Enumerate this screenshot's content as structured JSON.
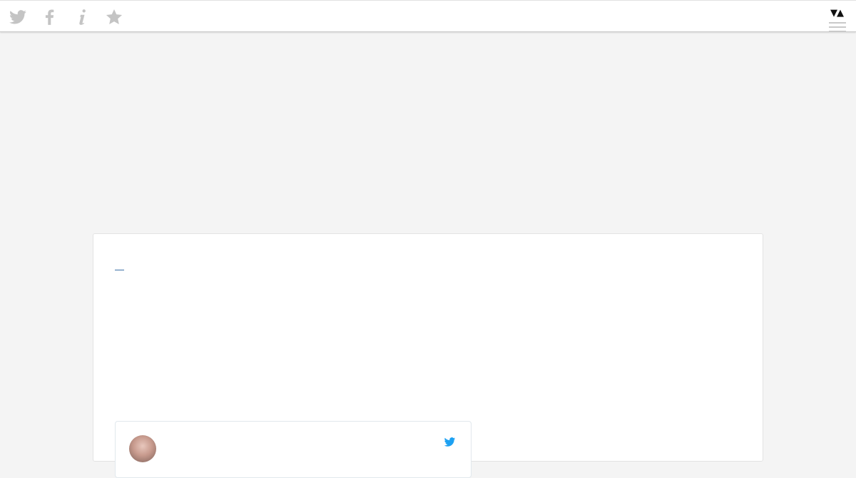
{
  "toolbar": {
    "icons": [
      "twitter-icon",
      "facebook-icon",
      "info-icon",
      "star-icon"
    ],
    "icon_color": "#c4c4c4",
    "sort_toggle_label": "▼▲"
  },
  "post": {
    "lines": [
      "",
      "",
      "",
      "",
      ""
    ],
    "link_color": "#3a6ea5"
  },
  "tweet": {
    "author_name": "",
    "icon": "twitter-bird-icon",
    "brand_color": "#1da1f2"
  }
}
